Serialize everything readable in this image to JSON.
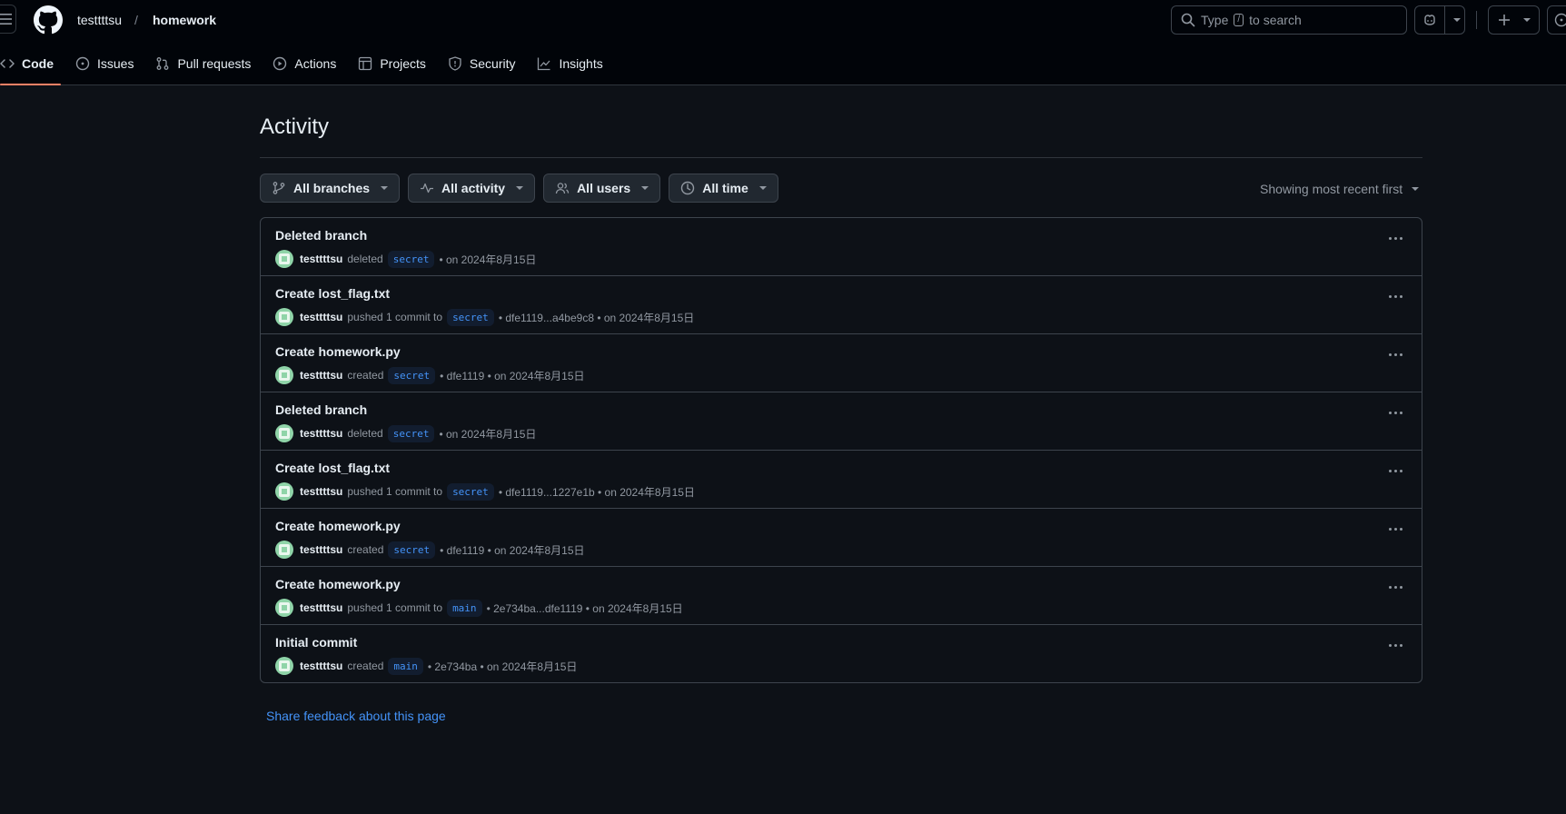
{
  "header": {
    "owner": "testtttsu",
    "separator": "/",
    "repo": "homework",
    "search_text": "Type",
    "search_key": "/",
    "search_suffix": "to search"
  },
  "tabs": [
    {
      "label": "Code",
      "icon": "code-icon",
      "active": true
    },
    {
      "label": "Issues",
      "icon": "issue-opened-icon"
    },
    {
      "label": "Pull requests",
      "icon": "git-pull-request-icon"
    },
    {
      "label": "Actions",
      "icon": "play-icon"
    },
    {
      "label": "Projects",
      "icon": "table-icon"
    },
    {
      "label": "Security",
      "icon": "shield-icon"
    },
    {
      "label": "Insights",
      "icon": "graph-icon"
    }
  ],
  "main": {
    "title": "Activity",
    "filters": {
      "branches": "All branches",
      "activity": "All activity",
      "users": "All users",
      "time": "All time"
    },
    "sort": "Showing most recent first",
    "feedback": "Share feedback about this page"
  },
  "activity": [
    {
      "title": "Deleted branch",
      "user": "testtttsu",
      "action": "deleted",
      "branch": "secret",
      "suffix": "• on 2024年8月15日"
    },
    {
      "title": "Create lost_flag.txt",
      "user": "testtttsu",
      "action": "pushed 1 commit to",
      "branch": "secret",
      "suffix": "• dfe1119...a4be9c8 • on 2024年8月15日"
    },
    {
      "title": "Create homework.py",
      "user": "testtttsu",
      "action": "created",
      "branch": "secret",
      "suffix": "• dfe1119 • on 2024年8月15日"
    },
    {
      "title": "Deleted branch",
      "user": "testtttsu",
      "action": "deleted",
      "branch": "secret",
      "suffix": "• on 2024年8月15日"
    },
    {
      "title": "Create lost_flag.txt",
      "user": "testtttsu",
      "action": "pushed 1 commit to",
      "branch": "secret",
      "suffix": "• dfe1119...1227e1b • on 2024年8月15日"
    },
    {
      "title": "Create homework.py",
      "user": "testtttsu",
      "action": "created",
      "branch": "secret",
      "suffix": "• dfe1119 • on 2024年8月15日"
    },
    {
      "title": "Create homework.py",
      "user": "testtttsu",
      "action": "pushed 1 commit to",
      "branch": "main",
      "suffix": "• 2e734ba...dfe1119 • on 2024年8月15日"
    },
    {
      "title": "Initial commit",
      "user": "testtttsu",
      "action": "created",
      "branch": "main",
      "suffix": "• 2e734ba • on 2024年8月15日"
    }
  ]
}
